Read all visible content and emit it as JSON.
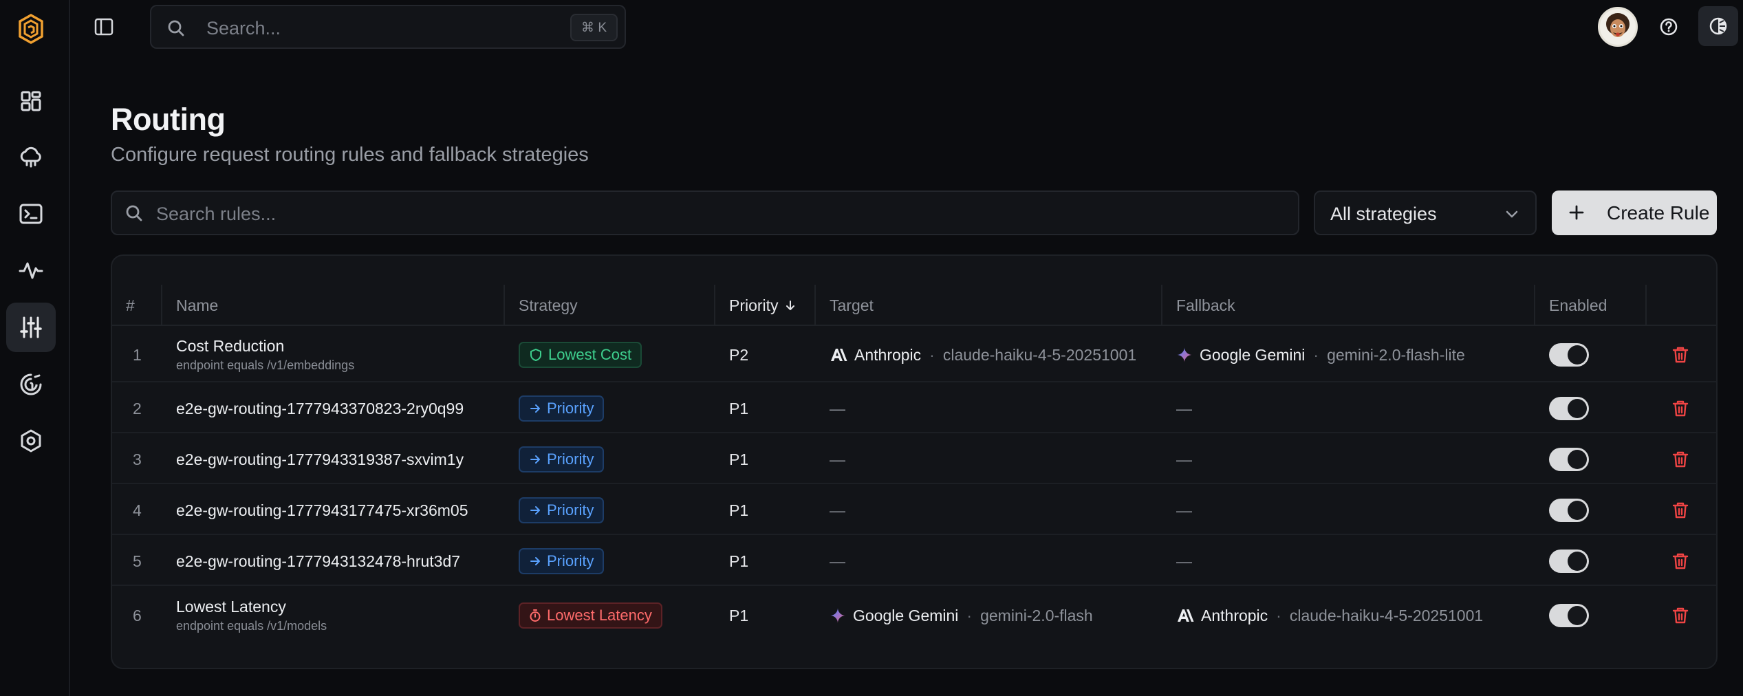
{
  "header": {
    "search_placeholder": "Search...",
    "shortcut": "⌘ K"
  },
  "page": {
    "title": "Routing",
    "subtitle": "Configure request routing rules and fallback strategies"
  },
  "toolbar": {
    "search_placeholder": "Search rules...",
    "strategy_filter": "All strategies",
    "create_label": "Create Rule"
  },
  "table": {
    "columns": {
      "index": "#",
      "name": "Name",
      "strategy": "Strategy",
      "priority": "Priority",
      "target": "Target",
      "fallback": "Fallback",
      "enabled": "Enabled"
    },
    "rows": [
      {
        "index": "1",
        "name": "Cost Reduction",
        "condition": "endpoint equals /v1/embeddings",
        "strategy": "Lowest Cost",
        "priority": "P2",
        "target_provider": "Anthropic",
        "target_model": "claude-haiku-4-5-20251001",
        "fallback_provider": "Google Gemini",
        "fallback_model": "gemini-2.0-flash-lite",
        "enabled": true
      },
      {
        "index": "2",
        "name": "e2e-gw-routing-1777943370823-2ry0q99",
        "condition": "",
        "strategy": "Priority",
        "priority": "P1",
        "target_dash": "—",
        "fallback_dash": "—",
        "enabled": true
      },
      {
        "index": "3",
        "name": "e2e-gw-routing-1777943319387-sxvim1y",
        "condition": "",
        "strategy": "Priority",
        "priority": "P1",
        "target_dash": "—",
        "fallback_dash": "—",
        "enabled": true
      },
      {
        "index": "4",
        "name": "e2e-gw-routing-1777943177475-xr36m05",
        "condition": "",
        "strategy": "Priority",
        "priority": "P1",
        "target_dash": "—",
        "fallback_dash": "—",
        "enabled": true
      },
      {
        "index": "5",
        "name": "e2e-gw-routing-1777943132478-hrut3d7",
        "condition": "",
        "strategy": "Priority",
        "priority": "P1",
        "target_dash": "—",
        "fallback_dash": "—",
        "enabled": true
      },
      {
        "index": "6",
        "name": "Lowest Latency",
        "condition": "endpoint equals /v1/models",
        "strategy": "Lowest Latency",
        "priority": "P1",
        "target_provider": "Google Gemini",
        "target_model": "gemini-2.0-flash",
        "fallback_provider": "Anthropic",
        "fallback_model": "claude-haiku-4-5-20251001",
        "enabled": true
      }
    ]
  },
  "colors": {
    "background": "#0b0c0f",
    "surface": "#121418",
    "cost_green": "#3ecf8e",
    "priority_blue": "#5aa2ff",
    "latency_red": "#ff6b6b",
    "brand_orange": "#f0a030"
  }
}
